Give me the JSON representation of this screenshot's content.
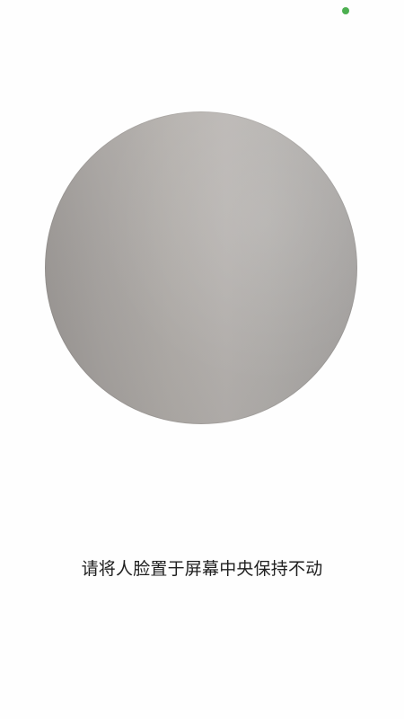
{
  "status": {
    "indicator_color": "#4caf50",
    "indicator_icon": "green-status-dot-icon"
  },
  "camera": {
    "shape": "circle"
  },
  "instruction": {
    "text": "请将人脸置于屏幕中央保持不动"
  }
}
